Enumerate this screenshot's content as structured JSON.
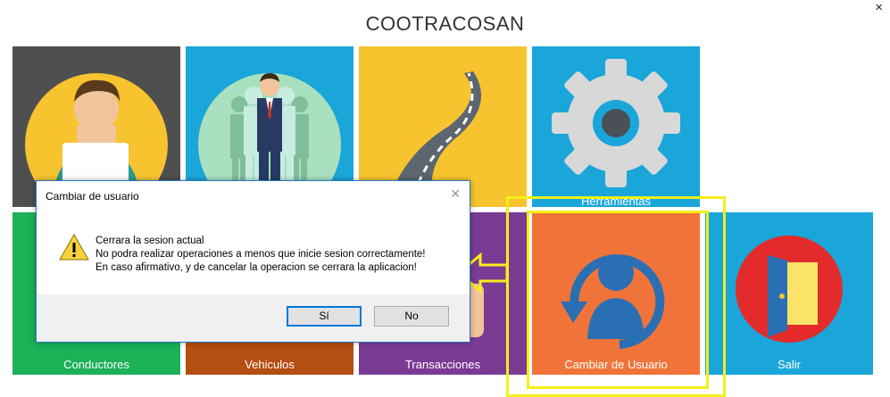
{
  "app": {
    "title": "COOTRACOSAN",
    "close_glyph": "×"
  },
  "tiles": {
    "conductores": {
      "label": "Conductores",
      "color": "#4f4f4f"
    },
    "clientes": {
      "label": "",
      "color": "#1aa6d9"
    },
    "rutas": {
      "label": "",
      "color": "#f7c32e"
    },
    "herramientas": {
      "label": "Herramientas",
      "color": "#1aa6d9"
    },
    "conductores_bottom": {
      "label": "Conductores",
      "color": "#1ab157"
    },
    "vehiculos": {
      "label": "Vehiculos",
      "color": "#b44e12"
    },
    "transacciones": {
      "label": "Transacciones",
      "color": "#7a3b94"
    },
    "cambiar_usuario": {
      "label": "Cambiar de Usuario",
      "color": "#f0743a"
    },
    "salir": {
      "label": "Salir",
      "color": "#1aa6d9"
    }
  },
  "dialog": {
    "title": "Cambiar de usuario",
    "close_glyph": "✕",
    "line1": "Cerrara la sesion actual",
    "line2": "No podra realizar operaciones a menos que inicie sesion correctamente!",
    "line3": "En caso afirmativo, y de cancelar la operacion se cerrara la aplicacion!",
    "yes_label": "Sí",
    "no_label": "No",
    "icon": "warning-icon"
  },
  "annotation": {
    "color": "#f4ef1a"
  }
}
